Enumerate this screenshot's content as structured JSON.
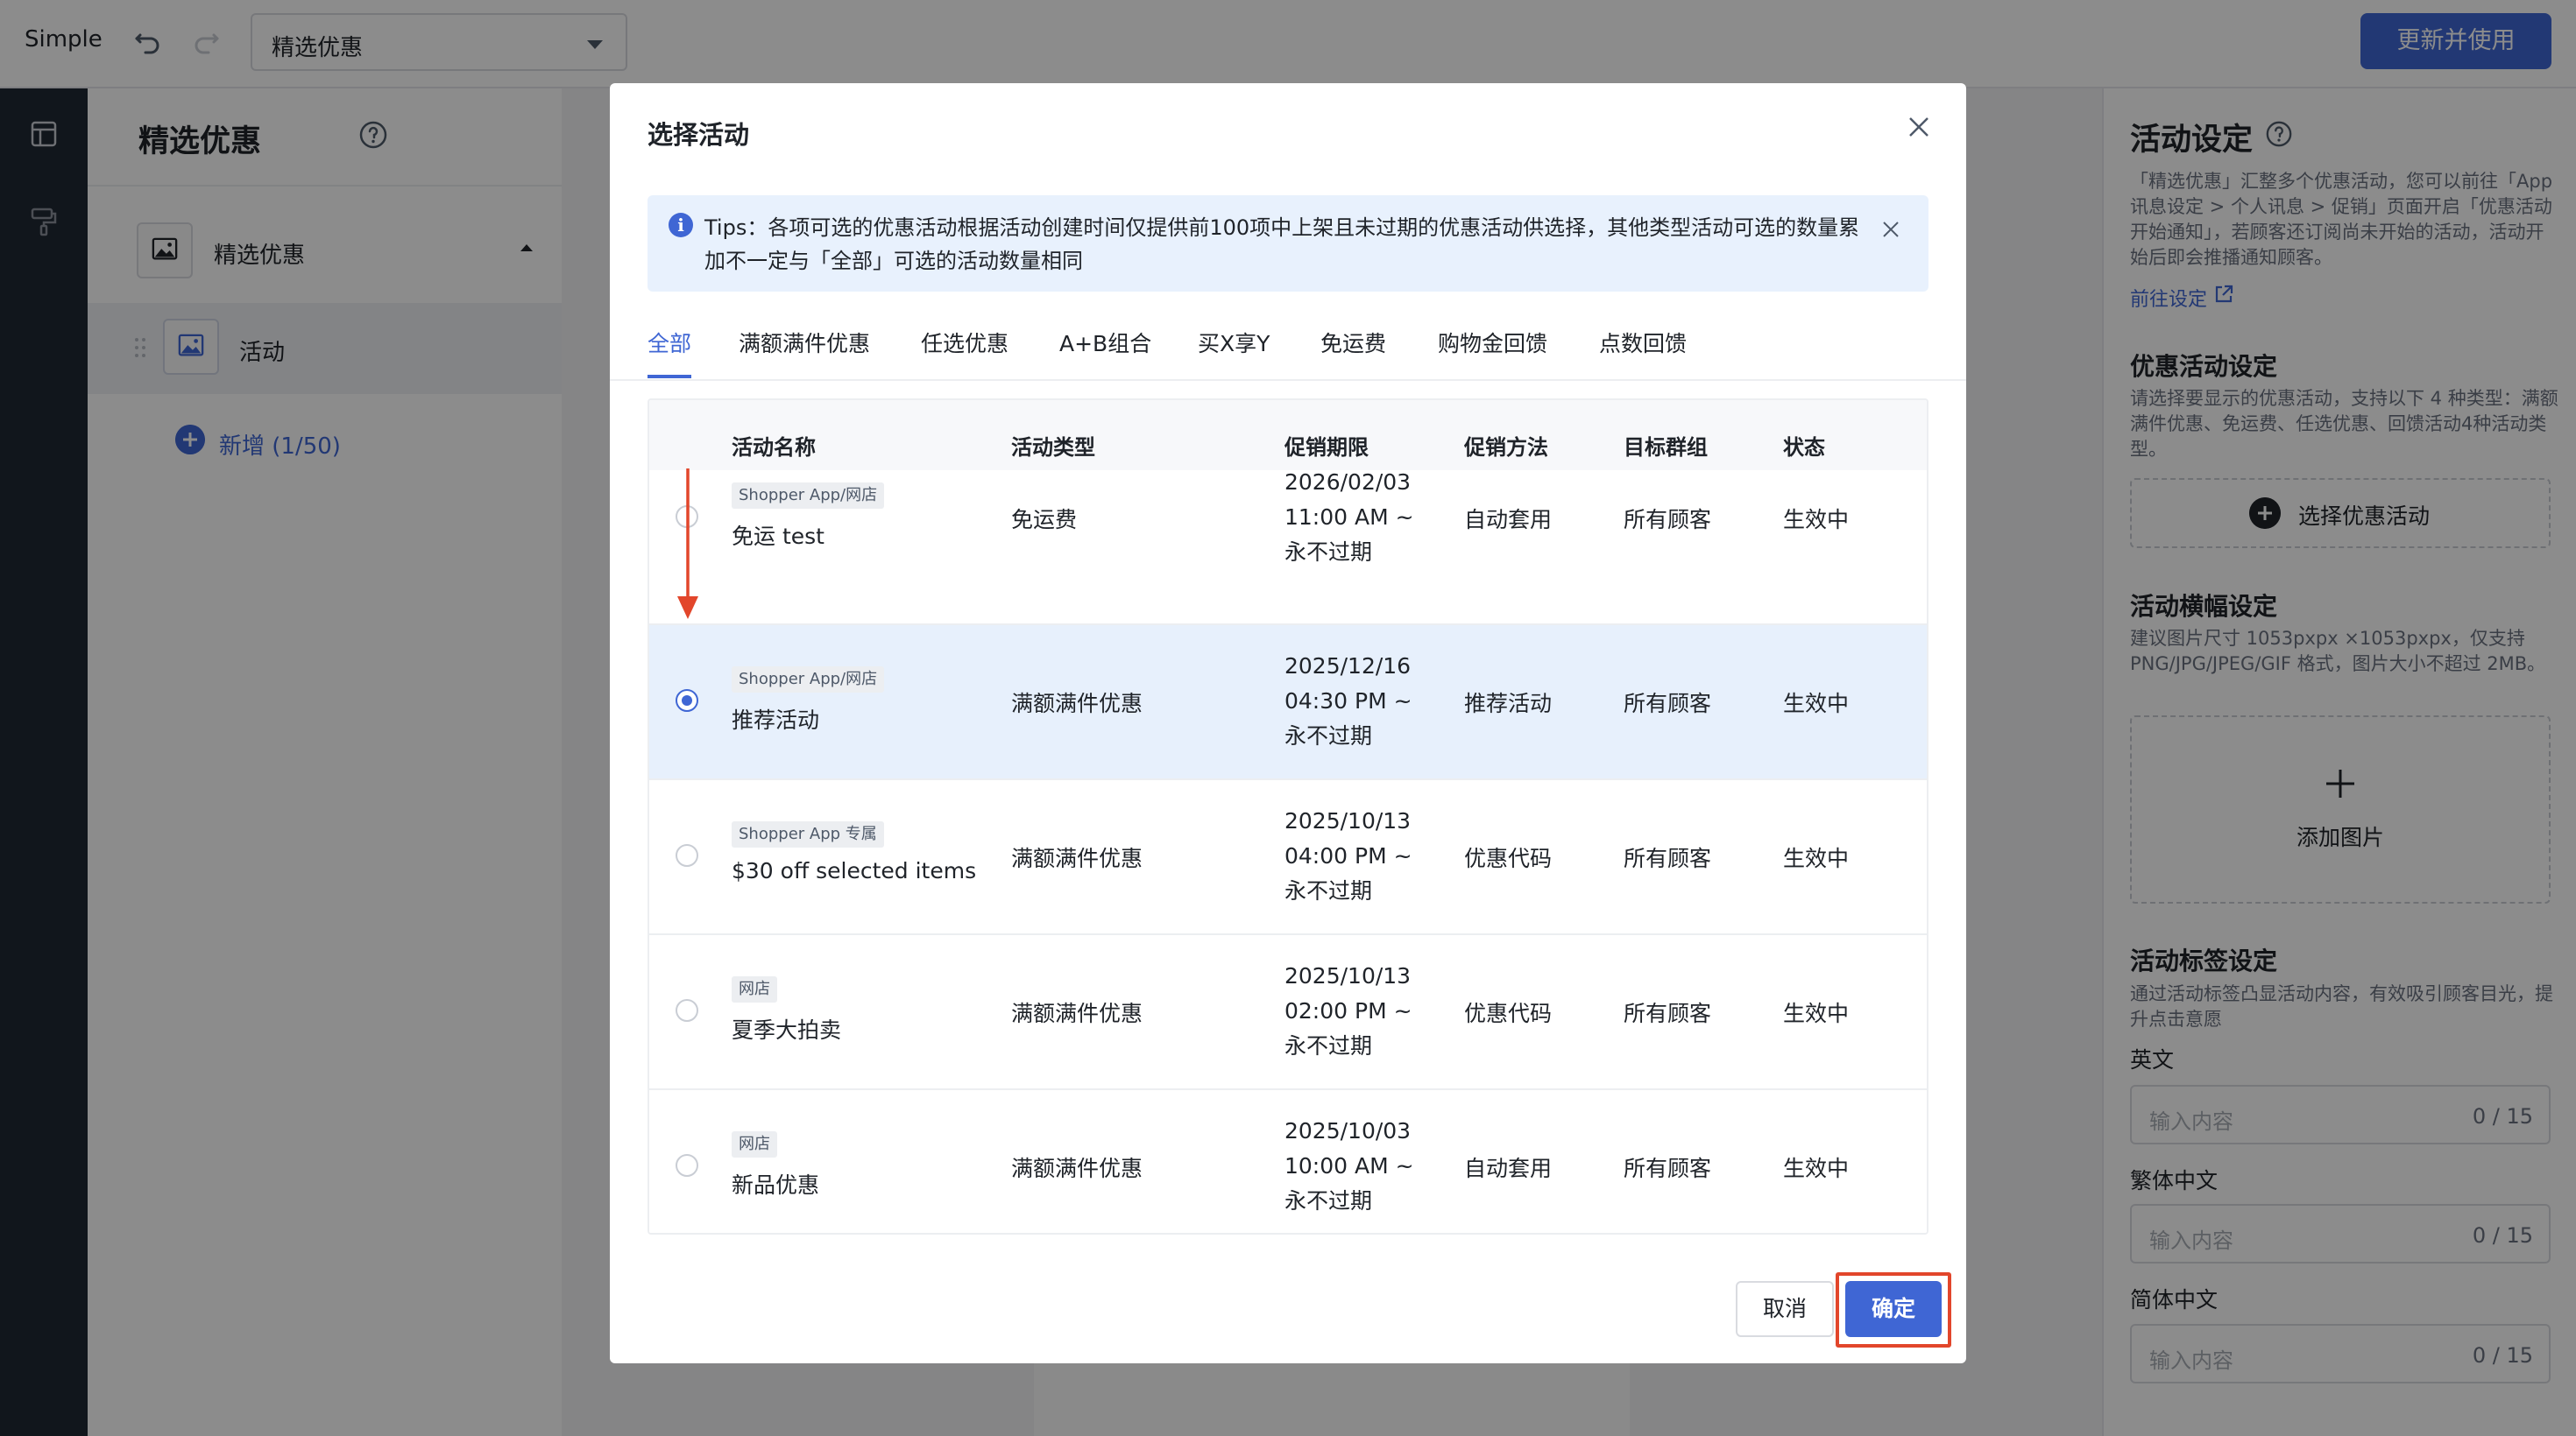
{
  "app": {
    "brand": "Simple",
    "page_select_value": "精选优惠",
    "update_button": "更新并使用"
  },
  "left_panel": {
    "title": "精选优惠",
    "root_item": "精选优惠",
    "child_item": "活动",
    "add_label": "新增 (1/50)"
  },
  "right_panel": {
    "title": "活动设定",
    "intro": "「精选优惠」汇整多个优惠活动，您可以前往「App讯息设定 > 个人讯息 > 促销」页面开启「优惠活动开始通知」，若顾客还订阅尚未开始的活动，活动开始后即会推播通知顾客。",
    "link": "前往设定",
    "promo_heading": "优惠活动设定",
    "promo_desc": "请选择要显示的优惠活动，支持以下 4 种类型：满额满件优惠、免运费、任选优惠、回馈活动4种活动类型。",
    "select_button": "选择优惠活动",
    "banner_heading": "活动横幅设定",
    "banner_desc": "建议图片尺寸 1053pxpx ×1053pxpx，仅支持 PNG/JPG/JPEG/GIF 格式，图片大小不超过 2MB。",
    "add_image": "添加图片",
    "tag_heading": "活动标签设定",
    "tag_desc": "通过活动标签凸显活动内容，有效吸引顾客目光，提升点击意愿",
    "fields": [
      {
        "label": "英文",
        "placeholder": "输入内容",
        "count": "0 / 15"
      },
      {
        "label": "繁体中文",
        "placeholder": "输入内容",
        "count": "0 / 15"
      },
      {
        "label": "简体中文",
        "placeholder": "输入内容",
        "count": "0 / 15"
      }
    ]
  },
  "modal": {
    "title": "选择活动",
    "tips": "Tips：各项可选的优惠活动根据活动创建时间仅提供前100项中上架且未过期的优惠活动供选择，其他类型活动可选的数量累加不一定与「全部」可选的活动数量相同",
    "tabs": [
      "全部",
      "满额满件优惠",
      "任选优惠",
      "A+B组合",
      "买X享Y",
      "免运费",
      "购物金回馈",
      "点数回馈"
    ],
    "active_tab": "全部",
    "columns": [
      "活动名称",
      "活动类型",
      "促销期限",
      "促销方法",
      "目标群组",
      "状态"
    ],
    "rows": [
      {
        "channel": "Shopper App/网店",
        "name": "免运 test",
        "type": "免运费",
        "period": [
          "2026/02/03",
          "11:00 AM ~",
          "永不过期"
        ],
        "method": "自动套用",
        "target": "所有顾客",
        "status": "生效中",
        "selected": false
      },
      {
        "channel": "Shopper App/网店",
        "name": "推荐活动",
        "type": "满额满件优惠",
        "period": [
          "2025/12/16",
          "04:30 PM ~",
          "永不过期"
        ],
        "method": "推荐活动",
        "target": "所有顾客",
        "status": "生效中",
        "selected": true
      },
      {
        "channel": "Shopper App 专属",
        "name": "$30 off selected items",
        "type": "满额满件优惠",
        "period": [
          "2025/10/13",
          "04:00 PM ~",
          "永不过期"
        ],
        "method": "优惠代码",
        "target": "所有顾客",
        "status": "生效中",
        "selected": false
      },
      {
        "channel": "网店",
        "name": "夏季大拍卖",
        "type": "满额满件优惠",
        "period": [
          "2025/10/13",
          "02:00 PM ~",
          "永不过期"
        ],
        "method": "优惠代码",
        "target": "所有顾客",
        "status": "生效中",
        "selected": false
      },
      {
        "channel": "网店",
        "name": "新品优惠",
        "type": "满额满件优惠",
        "period": [
          "2025/10/03",
          "10:00 AM ~",
          "永不过期"
        ],
        "method": "自动套用",
        "target": "所有顾客",
        "status": "生效中",
        "selected": false
      }
    ],
    "cancel": "取消",
    "confirm": "确定"
  },
  "colors": {
    "accent": "#3f66d4",
    "annotation": "#e2462b",
    "selected_row": "#e7f0fc"
  }
}
